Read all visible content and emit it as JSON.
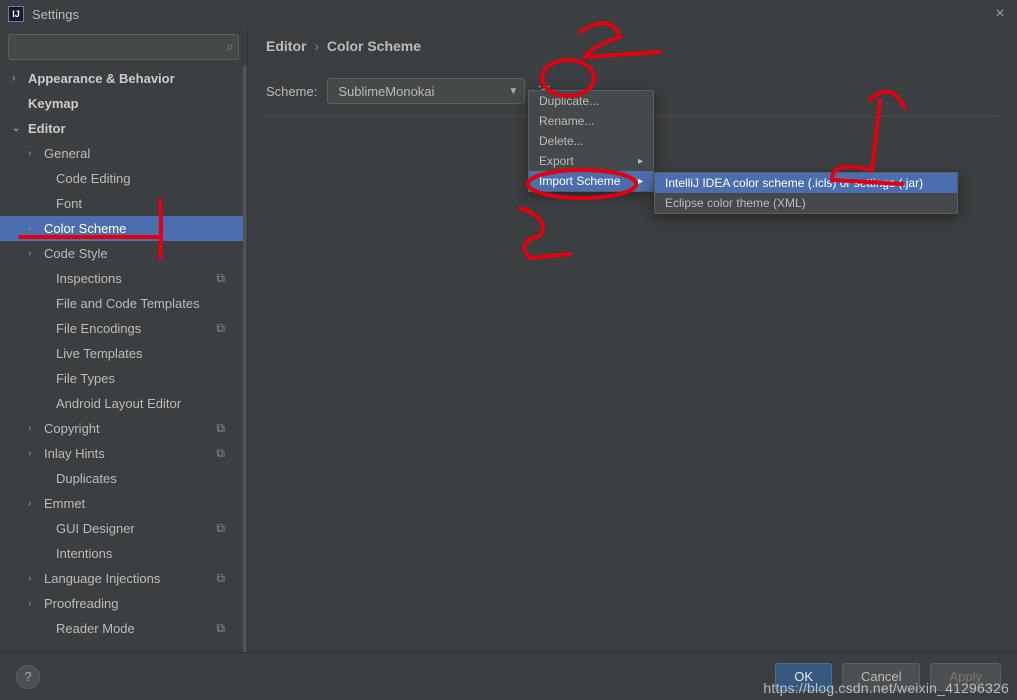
{
  "window": {
    "title": "Settings"
  },
  "search": {
    "placeholder": ""
  },
  "sidebar": {
    "items": [
      {
        "label": "Appearance & Behavior",
        "chev": "right",
        "bold": true,
        "level": 0
      },
      {
        "label": "Keymap",
        "chev": "none",
        "bold": true,
        "level": 0
      },
      {
        "label": "Editor",
        "chev": "down",
        "bold": true,
        "level": 0
      },
      {
        "label": "General",
        "chev": "right",
        "level": 1
      },
      {
        "label": "Code Editing",
        "chev": "none",
        "level": 1,
        "indent2": true
      },
      {
        "label": "Font",
        "chev": "none",
        "level": 1,
        "indent2": true
      },
      {
        "label": "Color Scheme",
        "chev": "right",
        "level": 1,
        "selected": true
      },
      {
        "label": "Code Style",
        "chev": "right",
        "level": 1
      },
      {
        "label": "Inspections",
        "chev": "none",
        "level": 1,
        "indent2": true,
        "icon": true
      },
      {
        "label": "File and Code Templates",
        "chev": "none",
        "level": 1,
        "indent2": true
      },
      {
        "label": "File Encodings",
        "chev": "none",
        "level": 1,
        "indent2": true,
        "icon": true
      },
      {
        "label": "Live Templates",
        "chev": "none",
        "level": 1,
        "indent2": true
      },
      {
        "label": "File Types",
        "chev": "none",
        "level": 1,
        "indent2": true
      },
      {
        "label": "Android Layout Editor",
        "chev": "none",
        "level": 1,
        "indent2": true
      },
      {
        "label": "Copyright",
        "chev": "right",
        "level": 1,
        "icon": true
      },
      {
        "label": "Inlay Hints",
        "chev": "right",
        "level": 1,
        "icon": true
      },
      {
        "label": "Duplicates",
        "chev": "none",
        "level": 1,
        "indent2": true
      },
      {
        "label": "Emmet",
        "chev": "right",
        "level": 1
      },
      {
        "label": "GUI Designer",
        "chev": "none",
        "level": 1,
        "indent2": true,
        "icon": true
      },
      {
        "label": "Intentions",
        "chev": "none",
        "level": 1,
        "indent2": true
      },
      {
        "label": "Language Injections",
        "chev": "right",
        "level": 1,
        "icon": true
      },
      {
        "label": "Proofreading",
        "chev": "right",
        "level": 1
      },
      {
        "label": "Reader Mode",
        "chev": "none",
        "level": 1,
        "indent2": true,
        "icon": true
      }
    ]
  },
  "breadcrumb": {
    "a": "Editor",
    "sep": "›",
    "b": "Color Scheme"
  },
  "scheme": {
    "label": "Scheme:",
    "value": "SublimeMonokai"
  },
  "popup": {
    "items": [
      {
        "label": "Duplicate..."
      },
      {
        "label": "Rename..."
      },
      {
        "label": "Delete..."
      },
      {
        "label": "Export",
        "sub": true
      },
      {
        "label": "Import Scheme",
        "sub": true,
        "highlight": true
      }
    ]
  },
  "submenu": {
    "items": [
      {
        "label": "IntelliJ IDEA color scheme (.icls) or settings (.jar)",
        "highlight": true
      },
      {
        "label": "Eclipse color theme (XML)"
      }
    ]
  },
  "footer": {
    "help": "?",
    "ok": "OK",
    "cancel": "Cancel",
    "apply": "Apply"
  },
  "watermark": "https://blog.csdn.net/weixin_41296326"
}
